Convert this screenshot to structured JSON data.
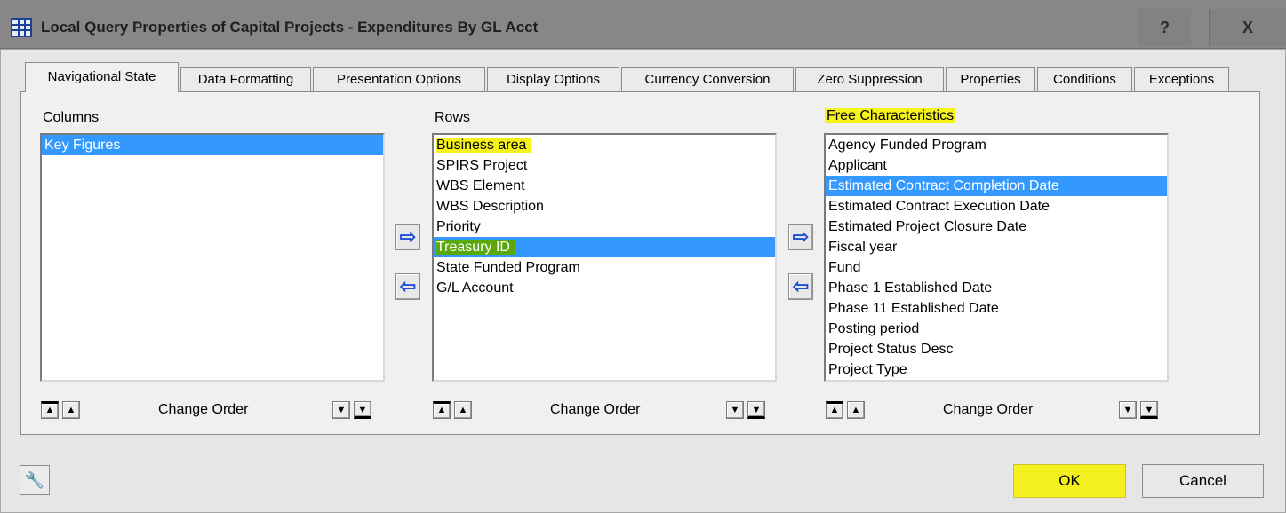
{
  "window": {
    "title": "Local Query Properties of Capital Projects - Expenditures By  GL Acct",
    "help_label": "?",
    "close_label": "X",
    "app_icon": "grid-table-icon"
  },
  "tabs": [
    {
      "label": "Navigational State",
      "active": true
    },
    {
      "label": "Data Formatting"
    },
    {
      "label": "Presentation Options"
    },
    {
      "label": "Display Options"
    },
    {
      "label": "Currency Conversion"
    },
    {
      "label": "Zero Suppression"
    },
    {
      "label": "Properties"
    },
    {
      "label": "Conditions"
    },
    {
      "label": "Exceptions"
    }
  ],
  "columns": {
    "label": "Columns",
    "items": [
      "Key Figures"
    ],
    "selected": "Key Figures"
  },
  "rows": {
    "label": "Rows",
    "items": [
      "Business area",
      "SPIRS Project",
      "WBS Element",
      "WBS Description",
      "Priority",
      "Treasury ID",
      "State Funded Program",
      "G/L Account"
    ],
    "selected": "Treasury ID"
  },
  "free": {
    "label": "Free Characteristics",
    "items": [
      "Agency Funded Program",
      "Applicant",
      "Estimated Contract Completion Date",
      "Estimated Contract Execution Date",
      "Estimated Project Closure Date",
      "Fiscal year",
      "Fund",
      "Phase 1 Established Date",
      "Phase 11 Established Date",
      "Posting period",
      "Project Status Desc",
      "Project Type"
    ],
    "selected": "Estimated Contract Completion Date"
  },
  "change_order_label": "Change Order",
  "buttons": {
    "ok": "OK",
    "cancel": "Cancel"
  },
  "colors": {
    "selection": "#3399ff",
    "highlight_yellow": "#f6f31a",
    "highlight_green": "#5aa80c",
    "arrow_blue": "#1f4fd6"
  }
}
